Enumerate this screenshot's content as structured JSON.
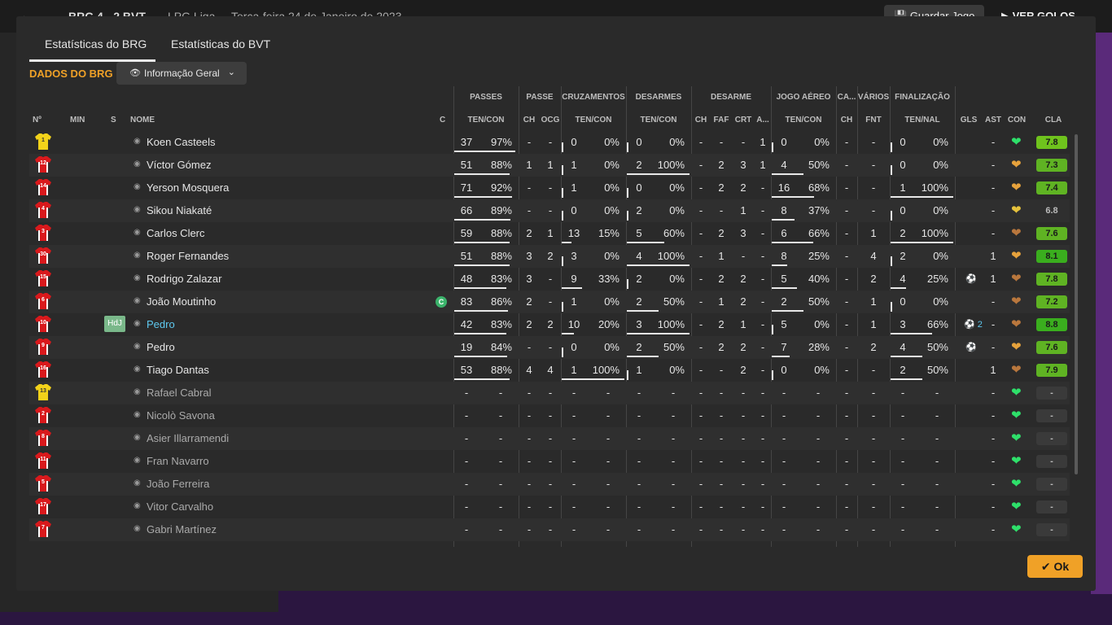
{
  "background": {
    "match_score": "BRG  4 - 2  BVT",
    "competition": "LPG Liga",
    "date": "Terça-feira 24 de Janeiro de 2023",
    "save_label": "Guardar Jogo",
    "goals_label": "VER GOLOS"
  },
  "tabs": [
    {
      "label": "Estatísticas do BRG",
      "active": true
    },
    {
      "label": "Estatísticas do BVT",
      "active": false
    }
  ],
  "section_title": "DADOS DO BRG",
  "view_select": {
    "value": "Informação Geral"
  },
  "group_headers": [
    "PASSES",
    "PASSE",
    "CRUZAMENTOS",
    "DESARMES",
    "DESARME",
    "JOGO AÉREO",
    "CA...",
    "VÁRIOS",
    "FINALIZAÇÃO"
  ],
  "columns": [
    "Nº",
    "MIN",
    "S",
    "NOME",
    "C",
    "TEN/CON",
    "CH",
    "OCG",
    "TEN/CON",
    "TEN/CON",
    "CH",
    "FAF",
    "CRT",
    "A...",
    "TEN/CON",
    "CH",
    "FNT",
    "TEN/NAL",
    "GLS",
    "AST",
    "CON",
    "CLA"
  ],
  "players": [
    {
      "num": "1",
      "kit": "gk",
      "name": "Koen Casteels",
      "pass_att": "37",
      "pass_pct": "97%",
      "pass_frac": 0.97,
      "ch": "-",
      "ocg": "-",
      "cr_att": "0",
      "cr_pct": "0%",
      "cr_frac": 0,
      "tk_att": "0",
      "tk_pct": "0%",
      "tk_frac": 0,
      "d_ch": "-",
      "faf": "-",
      "crt": "-",
      "a": "1",
      "air_att": "0",
      "air_pct": "0%",
      "air_frac": 0,
      "ca": "-",
      "fnt": "-",
      "sh_att": "0",
      "sh_pct": "0%",
      "sh_frac": 0,
      "gls": "",
      "ast": "-",
      "con": "green",
      "cla": "7.8",
      "cla_color": "#6fc31d"
    },
    {
      "num": "12",
      "kit": "out",
      "name": "Víctor Gómez",
      "pass_att": "51",
      "pass_pct": "88%",
      "pass_frac": 0.88,
      "ch": "1",
      "ocg": "1",
      "cr_att": "1",
      "cr_pct": "0%",
      "cr_frac": 0,
      "tk_att": "2",
      "tk_pct": "100%",
      "tk_frac": 1,
      "d_ch": "-",
      "faf": "2",
      "crt": "3",
      "a": "1",
      "air_att": "4",
      "air_pct": "50%",
      "air_frac": 0.5,
      "ca": "-",
      "fnt": "-",
      "sh_att": "0",
      "sh_pct": "0%",
      "sh_frac": 0,
      "gls": "",
      "ast": "-",
      "con": "orange",
      "cla": "7.3",
      "cla_color": "#5fb323"
    },
    {
      "num": "14",
      "kit": "out",
      "name": "Yerson Mosquera",
      "pass_att": "71",
      "pass_pct": "92%",
      "pass_frac": 0.92,
      "ch": "-",
      "ocg": "-",
      "cr_att": "1",
      "cr_pct": "0%",
      "cr_frac": 0,
      "tk_att": "0",
      "tk_pct": "0%",
      "tk_frac": 0,
      "d_ch": "-",
      "faf": "2",
      "crt": "2",
      "a": "-",
      "air_att": "16",
      "air_pct": "68%",
      "air_frac": 0.68,
      "ca": "-",
      "fnt": "-",
      "sh_att": "1",
      "sh_pct": "100%",
      "sh_frac": 1,
      "gls": "",
      "ast": "-",
      "con": "orange",
      "cla": "7.4",
      "cla_color": "#5fb323"
    },
    {
      "num": "4",
      "kit": "out",
      "name": "Sikou Niakaté",
      "pass_att": "66",
      "pass_pct": "89%",
      "pass_frac": 0.89,
      "ch": "-",
      "ocg": "-",
      "cr_att": "0",
      "cr_pct": "0%",
      "cr_frac": 0,
      "tk_att": "2",
      "tk_pct": "0%",
      "tk_frac": 0,
      "d_ch": "-",
      "faf": "-",
      "crt": "1",
      "a": "-",
      "air_att": "8",
      "air_pct": "37%",
      "air_frac": 0.37,
      "ca": "-",
      "fnt": "-",
      "sh_att": "0",
      "sh_pct": "0%",
      "sh_frac": 0,
      "gls": "",
      "ast": "-",
      "con": "yellow",
      "cla": "6.8",
      "cla_color": ""
    },
    {
      "num": "3",
      "kit": "out",
      "name": "Carlos Clerc",
      "pass_att": "59",
      "pass_pct": "88%",
      "pass_frac": 0.88,
      "ch": "2",
      "ocg": "1",
      "cr_att": "13",
      "cr_pct": "15%",
      "cr_frac": 0.15,
      "tk_att": "5",
      "tk_pct": "60%",
      "tk_frac": 0.6,
      "d_ch": "-",
      "faf": "2",
      "crt": "3",
      "a": "-",
      "air_att": "6",
      "air_pct": "66%",
      "air_frac": 0.66,
      "ca": "-",
      "fnt": "1",
      "sh_att": "2",
      "sh_pct": "100%",
      "sh_frac": 1,
      "gls": "",
      "ast": "-",
      "con": "brown",
      "cla": "7.6",
      "cla_color": "#5fb323"
    },
    {
      "num": "30",
      "kit": "out",
      "name": "Roger Fernandes",
      "pass_att": "51",
      "pass_pct": "88%",
      "pass_frac": 0.88,
      "ch": "3",
      "ocg": "2",
      "cr_att": "3",
      "cr_pct": "0%",
      "cr_frac": 0,
      "tk_att": "4",
      "tk_pct": "100%",
      "tk_frac": 1,
      "d_ch": "-",
      "faf": "1",
      "crt": "-",
      "a": "-",
      "air_att": "8",
      "air_pct": "25%",
      "air_frac": 0.25,
      "ca": "-",
      "fnt": "4",
      "sh_att": "2",
      "sh_pct": "0%",
      "sh_frac": 0,
      "gls": "",
      "ast": "1",
      "con": "orange",
      "cla": "8.1",
      "cla_color": "#3aae1e"
    },
    {
      "num": "15",
      "kit": "out",
      "name": "Rodrigo Zalazar",
      "pass_att": "48",
      "pass_pct": "83%",
      "pass_frac": 0.83,
      "ch": "3",
      "ocg": "-",
      "cr_att": "9",
      "cr_pct": "33%",
      "cr_frac": 0.33,
      "tk_att": "2",
      "tk_pct": "0%",
      "tk_frac": 0,
      "d_ch": "-",
      "faf": "2",
      "crt": "2",
      "a": "-",
      "air_att": "5",
      "air_pct": "40%",
      "air_frac": 0.4,
      "ca": "-",
      "fnt": "2",
      "sh_att": "4",
      "sh_pct": "25%",
      "sh_frac": 0.25,
      "gls": "ball",
      "ast": "1",
      "con": "brown",
      "cla": "7.8",
      "cla_color": "#5fb323"
    },
    {
      "num": "6",
      "kit": "out",
      "name": "João Moutinho",
      "captain": true,
      "pass_att": "83",
      "pass_pct": "86%",
      "pass_frac": 0.86,
      "ch": "2",
      "ocg": "-",
      "cr_att": "1",
      "cr_pct": "0%",
      "cr_frac": 0,
      "tk_att": "2",
      "tk_pct": "50%",
      "tk_frac": 0.5,
      "d_ch": "-",
      "faf": "1",
      "crt": "2",
      "a": "-",
      "air_att": "2",
      "air_pct": "50%",
      "air_frac": 0.5,
      "ca": "-",
      "fnt": "1",
      "sh_att": "0",
      "sh_pct": "0%",
      "sh_frac": 0,
      "gls": "",
      "ast": "-",
      "con": "brown",
      "cla": "7.2",
      "cla_color": "#5fb323"
    },
    {
      "num": "10",
      "kit": "out",
      "name": "Pedro",
      "highlight": true,
      "sub": "HdJ",
      "pass_att": "42",
      "pass_pct": "83%",
      "pass_frac": 0.83,
      "ch": "2",
      "ocg": "2",
      "cr_att": "10",
      "cr_pct": "20%",
      "cr_frac": 0.2,
      "tk_att": "3",
      "tk_pct": "100%",
      "tk_frac": 1,
      "d_ch": "-",
      "faf": "2",
      "crt": "1",
      "a": "-",
      "air_att": "5",
      "air_pct": "0%",
      "air_frac": 0,
      "ca": "-",
      "fnt": "1",
      "sh_att": "3",
      "sh_pct": "66%",
      "sh_frac": 0.66,
      "gls": "ball2",
      "ast": "-",
      "con": "brown",
      "cla": "8.8",
      "cla_color": "#3aae1e"
    },
    {
      "num": "9",
      "kit": "out",
      "name": "Pedro",
      "pass_att": "19",
      "pass_pct": "84%",
      "pass_frac": 0.84,
      "ch": "-",
      "ocg": "-",
      "cr_att": "0",
      "cr_pct": "0%",
      "cr_frac": 0,
      "tk_att": "2",
      "tk_pct": "50%",
      "tk_frac": 0.5,
      "d_ch": "-",
      "faf": "2",
      "crt": "2",
      "a": "-",
      "air_att": "7",
      "air_pct": "28%",
      "air_frac": 0.28,
      "ca": "-",
      "fnt": "2",
      "sh_att": "4",
      "sh_pct": "50%",
      "sh_frac": 0.5,
      "gls": "ball",
      "ast": "-",
      "con": "orange",
      "cla": "7.6",
      "cla_color": "#5fb323"
    },
    {
      "num": "16",
      "kit": "out",
      "name": "Tiago Dantas",
      "pass_att": "53",
      "pass_pct": "88%",
      "pass_frac": 0.88,
      "ch": "4",
      "ocg": "4",
      "cr_att": "1",
      "cr_pct": "100%",
      "cr_frac": 1,
      "tk_att": "1",
      "tk_pct": "0%",
      "tk_frac": 0,
      "d_ch": "-",
      "faf": "-",
      "crt": "2",
      "a": "-",
      "air_att": "0",
      "air_pct": "0%",
      "air_frac": 0,
      "ca": "-",
      "fnt": "-",
      "sh_att": "2",
      "sh_pct": "50%",
      "sh_frac": 0.5,
      "gls": "",
      "ast": "1",
      "con": "brown",
      "cla": "7.9",
      "cla_color": "#5fb323"
    },
    {
      "num": "13",
      "kit": "gk",
      "name": "Rafael Cabral",
      "dim": true,
      "con": "green",
      "cla": "-"
    },
    {
      "num": "2",
      "kit": "out",
      "name": "Nicolò Savona",
      "dim": true,
      "con": "green",
      "cla": "-"
    },
    {
      "num": "8",
      "kit": "out",
      "name": "Asier Illarramendi",
      "dim": true,
      "con": "green",
      "cla": "-"
    },
    {
      "num": "11",
      "kit": "out",
      "name": "Fran Navarro",
      "dim": true,
      "con": "green",
      "cla": "-"
    },
    {
      "num": "5",
      "kit": "out",
      "name": "João Ferreira",
      "dim": true,
      "con": "green",
      "cla": "-"
    },
    {
      "num": "17",
      "kit": "out",
      "name": "Vitor Carvalho",
      "dim": true,
      "con": "green",
      "cla": "-"
    },
    {
      "num": "7",
      "kit": "out",
      "name": "Gabri Martínez",
      "dim": true,
      "con": "green",
      "cla": "-"
    }
  ],
  "ok_label": "Ok",
  "colors": {
    "accent": "#f0a127",
    "kit_gk": "#f2d21a",
    "kit_out": "#d9191c",
    "highlight": "#5ec9f0"
  }
}
